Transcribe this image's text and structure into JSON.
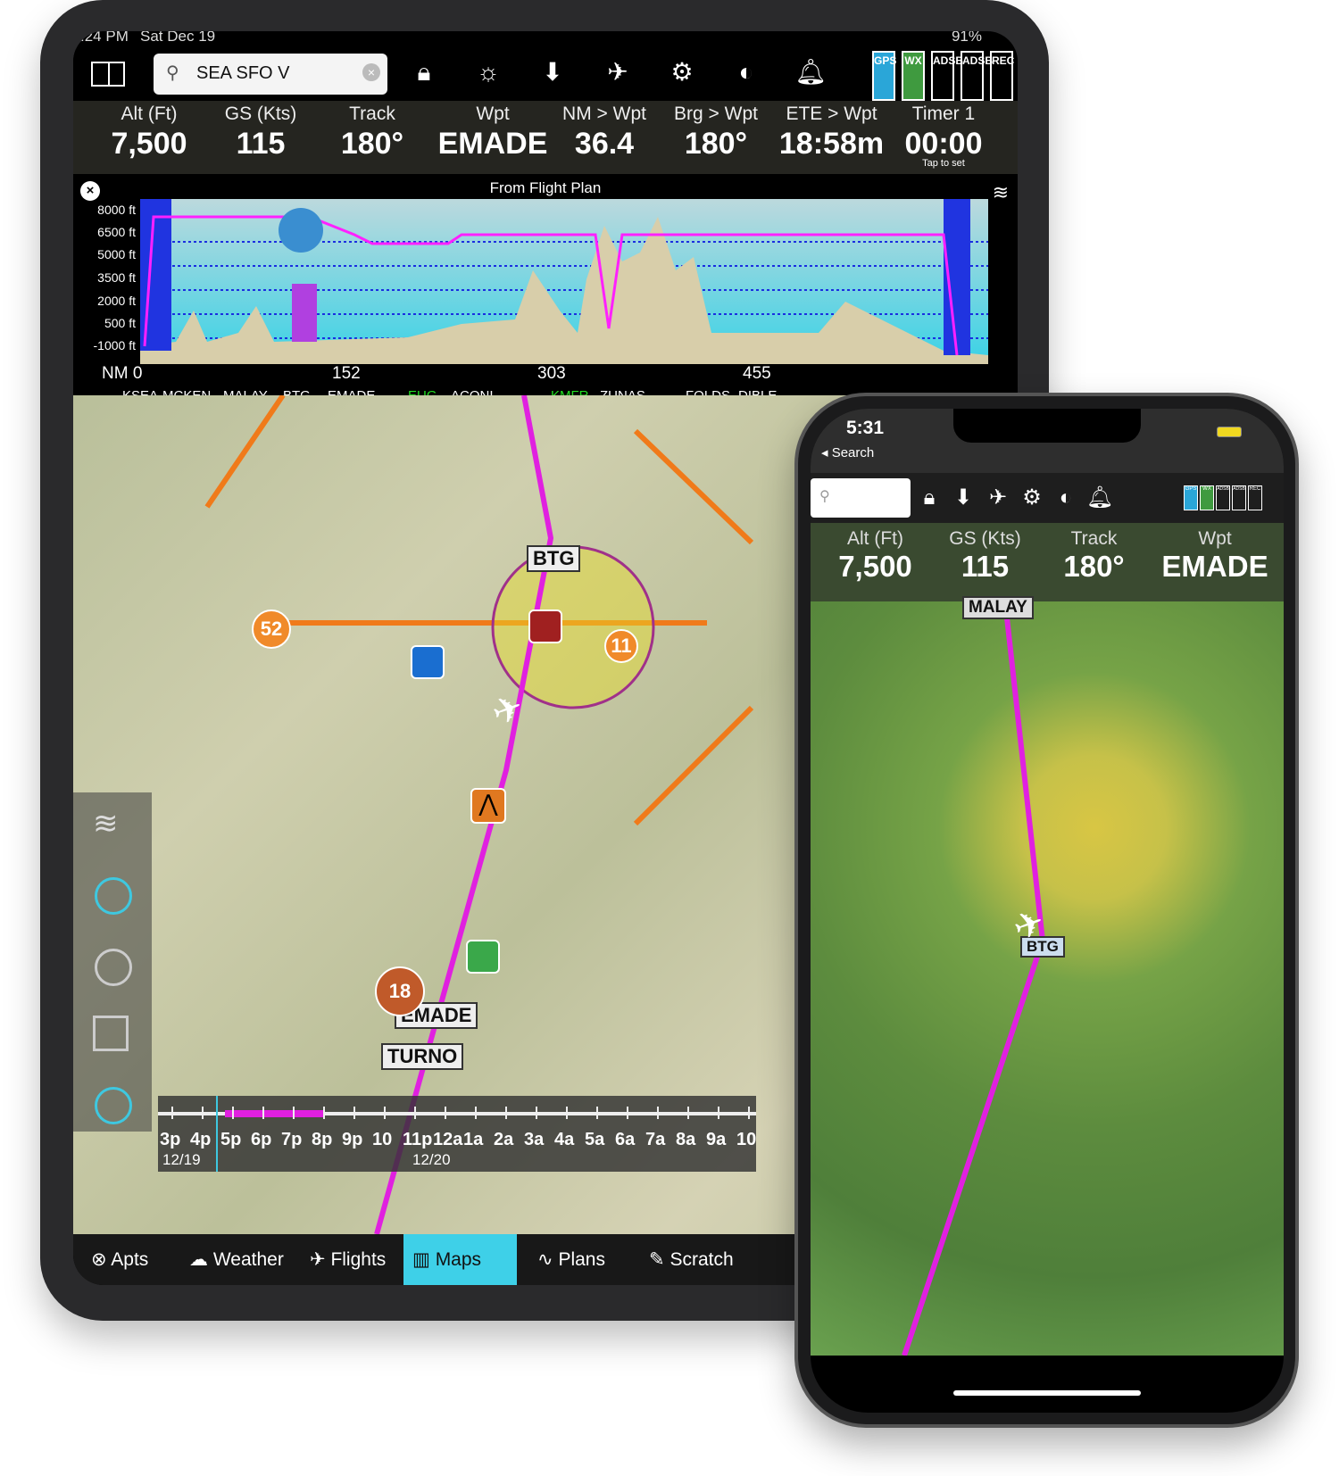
{
  "ipad": {
    "status": {
      "time": ":24 PM",
      "date": "Sat Dec 19",
      "battery": "91%"
    },
    "toolbar": {
      "search_value": "SEA SFO V",
      "icons": [
        "split-view-icon",
        "lock-icon",
        "brightness-icon",
        "download-icon",
        "airplane-icon",
        "gear-icon",
        "contrast-icon",
        "bell-icon"
      ],
      "badges": [
        {
          "label": "GPS",
          "color": "#2aa6d8"
        },
        {
          "label": "WX",
          "color": "#3f9a3f"
        },
        {
          "label": "ADSB",
          "color": "#000000"
        },
        {
          "label": "ADSB",
          "color": "#000000"
        },
        {
          "label": "REC",
          "color": "#000000"
        }
      ]
    },
    "instruments": [
      {
        "label": "Alt (Ft)",
        "value": "7,500"
      },
      {
        "label": "GS (Kts)",
        "value": "115"
      },
      {
        "label": "Track",
        "value": "180°"
      },
      {
        "label": "Wpt",
        "value": "EMADE"
      },
      {
        "label": "NM > Wpt",
        "value": "36.4"
      },
      {
        "label": "Brg > Wpt",
        "value": "180°"
      },
      {
        "label": "ETE > Wpt",
        "value": "18:58m"
      },
      {
        "label": "Timer 1",
        "value": "00:00",
        "sub": "Tap to set"
      }
    ],
    "profile": {
      "title": "From Flight Plan",
      "y_ticks": [
        "8000 ft",
        "6500 ft",
        "5000 ft",
        "3500 ft",
        "2000 ft",
        "500 ft",
        "-1000 ft"
      ],
      "x_ticks": [
        "NM 0",
        "152",
        "303",
        "455"
      ],
      "waypoints": [
        {
          "name": "KSEA"
        },
        {
          "name": "MCKEN"
        },
        {
          "name": "MALAY"
        },
        {
          "name": "BTG"
        },
        {
          "name": "EMADE"
        },
        {
          "name": "EUG",
          "color": "#22dd22"
        },
        {
          "name": "ACONI"
        },
        {
          "name": "KMFR",
          "color": "#22dd22"
        },
        {
          "name": "ZUNAS"
        },
        {
          "name": "FOLDS"
        },
        {
          "name": "DIBLE"
        }
      ]
    },
    "map": {
      "labels": [
        "BTG",
        "EMADE",
        "TURNO"
      ],
      "markers": [
        "52",
        "11",
        "18"
      ],
      "route_color": "#e020e0"
    },
    "time_slider": {
      "hours": [
        "3p",
        "4p",
        "5p",
        "6p",
        "7p",
        "8p",
        "9p",
        "10",
        "11p",
        "12a",
        "1a",
        "2a",
        "3a",
        "4a",
        "5a",
        "6a",
        "7a",
        "8a",
        "9a",
        "10"
      ],
      "dates": [
        "12/19",
        "12/20"
      ]
    },
    "tabs": [
      {
        "label": "Apts",
        "icon": "airport-icon"
      },
      {
        "label": "Weather",
        "icon": "weather-icon"
      },
      {
        "label": "Flights",
        "icon": "flights-icon"
      },
      {
        "label": "Maps",
        "icon": "maps-icon",
        "active": true
      },
      {
        "label": "Plans",
        "icon": "plans-icon"
      },
      {
        "label": "Scratch",
        "icon": "scratch-icon"
      }
    ]
  },
  "phone": {
    "status": {
      "time": "5:31",
      "back": "◂ Search"
    },
    "toolbar": {
      "search_value": "",
      "badges": [
        "GPS",
        "WX",
        "ADSB",
        "ADSB",
        "REC"
      ]
    },
    "instruments": [
      {
        "label": "Alt (Ft)",
        "value": "7,500"
      },
      {
        "label": "GS (Kts)",
        "value": "115"
      },
      {
        "label": "Track",
        "value": "180°"
      },
      {
        "label": "Wpt",
        "value": "EMADE"
      }
    ],
    "map": {
      "labels": [
        "MALAY",
        "BTG"
      ]
    }
  }
}
